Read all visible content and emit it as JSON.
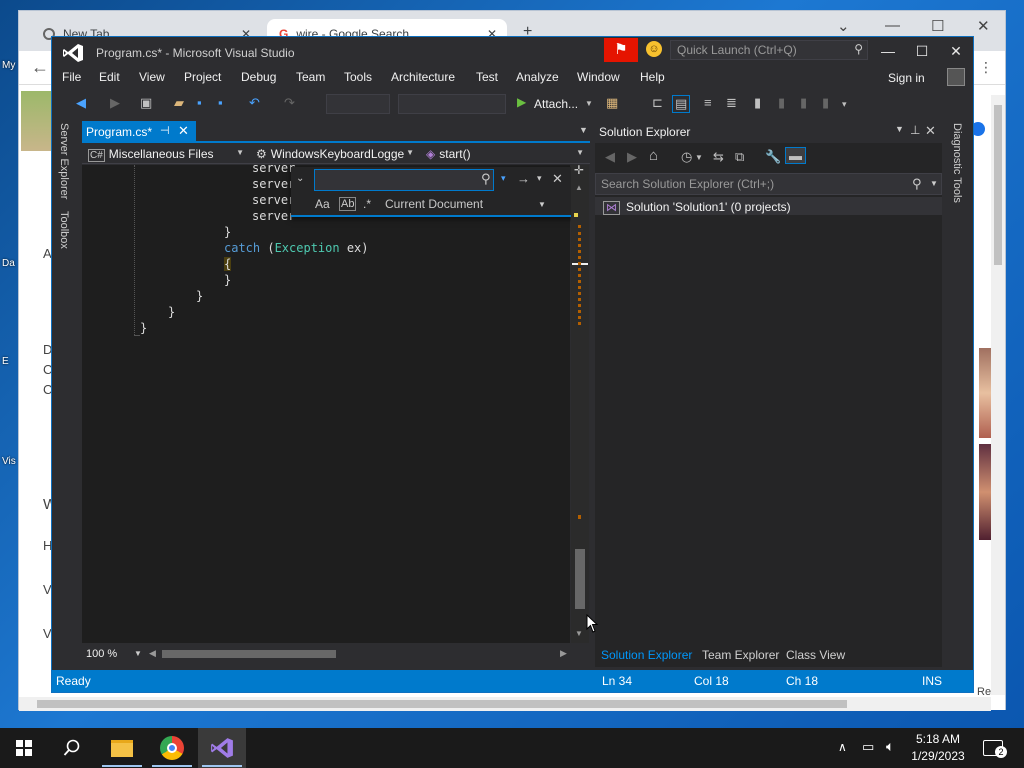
{
  "chrome": {
    "tabs": [
      {
        "label": "New Tab"
      },
      {
        "label": "wire - Google Search"
      }
    ],
    "ghost_text": [
      "My",
      "Da",
      "E",
      "Vis",
      "A",
      "D",
      "C",
      "C",
      "W",
      "H",
      "V",
      "V"
    ],
    "right_ghost": [
      "Re"
    ]
  },
  "vs": {
    "title": "Program.cs* - Microsoft Visual Studio",
    "quick_launch_placeholder": "Quick Launch (Ctrl+Q)",
    "menu": [
      "File",
      "Edit",
      "View",
      "Project",
      "Debug",
      "Team",
      "Tools",
      "Architecture",
      "Test",
      "Analyze",
      "Window",
      "Help"
    ],
    "sign_in": "Sign in",
    "toolbar": {
      "attach_label": "Attach..."
    },
    "left_strip": {
      "server_explorer": "Server Explorer",
      "toolbox": "Toolbox"
    },
    "right_strip": {
      "diagnostic_tools": "Diagnostic Tools"
    },
    "editor": {
      "tab_label": "Program.cs*",
      "nav": {
        "files": "Miscellaneous Files",
        "type": "WindowsKeyboardLogge",
        "member": "start()"
      },
      "code": [
        {
          "indent": 20,
          "text": "server"
        },
        {
          "indent": 20,
          "text": "server"
        },
        {
          "indent": 20,
          "text": "server"
        },
        {
          "indent": 20,
          "text": "server"
        },
        {
          "indent": 16,
          "text": "}"
        },
        {
          "indent": 16,
          "kw": "catch",
          "rest_open": " (",
          "type": "Exception",
          "rest_close": " ex)"
        },
        {
          "indent": 16,
          "text": "{"
        },
        {
          "indent": 16,
          "text": "}"
        },
        {
          "indent": 12,
          "text": "}"
        },
        {
          "indent": 8,
          "text": "}"
        },
        {
          "indent": 4,
          "text": "}"
        }
      ],
      "zoom": "100 %",
      "find": {
        "value": "",
        "case_label": "Aa",
        "word_label": "Ab",
        "regex_label": ".*",
        "scope": "Current Document"
      }
    },
    "solution_explorer": {
      "title": "Solution Explorer",
      "search_placeholder": "Search Solution Explorer (Ctrl+;)",
      "item": "Solution 'Solution1' (0 projects)",
      "tabs": [
        "Solution Explorer",
        "Team Explorer",
        "Class View"
      ]
    },
    "status": {
      "ready": "Ready",
      "line": "Ln 34",
      "col": "Col 18",
      "ch": "Ch 18",
      "mode": "INS"
    }
  },
  "taskbar": {
    "time": "5:18 AM",
    "date": "1/29/2023",
    "notification_count": "2"
  },
  "colors": {
    "accent": "#007acc",
    "vs_bg": "#2d2d30",
    "editor_bg": "#1e1e1e",
    "notif_red": "#e51400"
  }
}
